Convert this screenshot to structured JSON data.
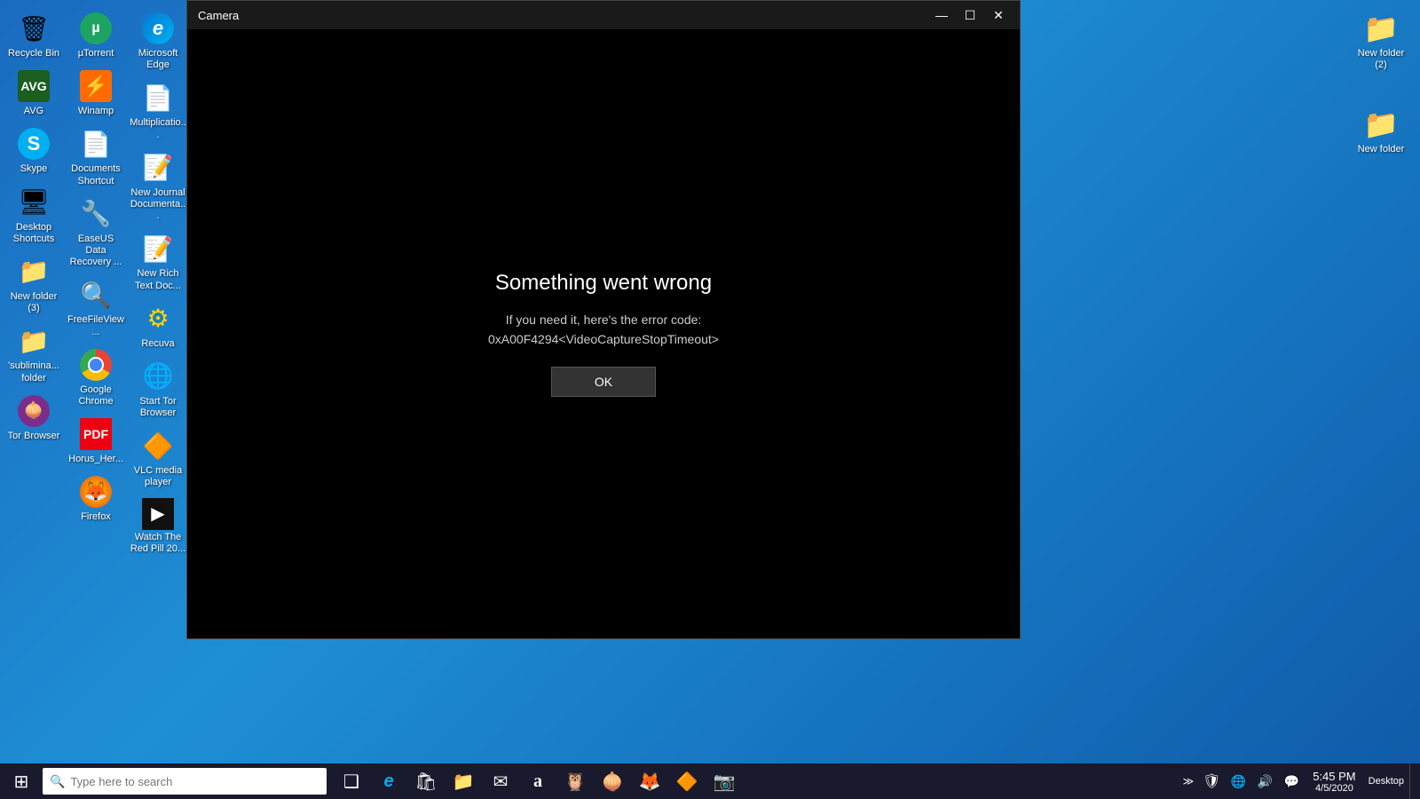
{
  "desktop": {
    "background": "blue gradient"
  },
  "left_icons": {
    "col1": [
      {
        "label": "Recycle Bin",
        "icon": "recycle-bin-icon",
        "symbol": "🗑"
      },
      {
        "label": "AVG",
        "icon": "avg-icon",
        "symbol": "AVG"
      },
      {
        "label": "Skype",
        "icon": "skype-icon",
        "symbol": "S"
      },
      {
        "label": "Desktop Shortcuts",
        "icon": "desktop-shortcuts-icon",
        "symbol": "🖥"
      },
      {
        "label": "New folder (3)",
        "icon": "new-folder3-icon",
        "symbol": "📁"
      },
      {
        "label": "'sublimina... folder",
        "icon": "subliminal-folder-icon",
        "symbol": "📁"
      },
      {
        "label": "Tor Browser",
        "icon": "tor-browser-icon",
        "symbol": "🧅"
      }
    ],
    "col2": [
      {
        "label": "µTorrent",
        "icon": "utorrent-icon",
        "symbol": "µ"
      },
      {
        "label": "Winamp",
        "icon": "winamp-icon",
        "symbol": "⚡"
      },
      {
        "label": "Documents Shortcut",
        "icon": "documents-shortcut-icon",
        "symbol": "📄"
      },
      {
        "label": "EaseUS Data Recovery ...",
        "icon": "easeus-icon",
        "symbol": "🔧"
      },
      {
        "label": "FreeFileView...",
        "icon": "freefileview-icon",
        "symbol": "🔍"
      },
      {
        "label": "Google Chrome",
        "icon": "google-chrome-icon",
        "symbol": ""
      },
      {
        "label": "Horus_Her...",
        "icon": "horus-icon",
        "symbol": "📄"
      },
      {
        "label": "Firefox",
        "icon": "firefox-icon",
        "symbol": "🦊"
      }
    ],
    "col3": [
      {
        "label": "Microsoft Edge",
        "icon": "microsoft-edge-icon",
        "symbol": "e"
      },
      {
        "label": "Multiplicatio...",
        "icon": "multiplication-icon",
        "symbol": "📄"
      },
      {
        "label": "New Journal Documenta...",
        "icon": "new-journal-icon",
        "symbol": "📝"
      },
      {
        "label": "New Rich Text Doc...",
        "icon": "new-richtext-icon",
        "symbol": "📝"
      },
      {
        "label": "Recuva",
        "icon": "recuva-icon",
        "symbol": "🔄"
      },
      {
        "label": "Start Tor Browser",
        "icon": "start-tor-icon",
        "symbol": "🌐"
      },
      {
        "label": "VLC media player",
        "icon": "vlc-icon",
        "symbol": "🔶"
      },
      {
        "label": "Watch The Red Pill 20...",
        "icon": "video-icon",
        "symbol": "▶"
      }
    ]
  },
  "right_icons": [
    {
      "label": "New folder (2)",
      "icon": "new-folder2-icon",
      "symbol": "📁"
    },
    {
      "label": "New folder",
      "icon": "new-folder-icon",
      "symbol": "📁"
    }
  ],
  "camera_window": {
    "title": "Camera",
    "error_title": "Something went wrong",
    "error_message": "If you need it, here's the error code:\n0xA00F4294<VideoCaptureStopTimeout>",
    "ok_button": "OK",
    "minimize_title": "Minimize",
    "maximize_title": "Maximize",
    "close_title": "Close"
  },
  "taskbar": {
    "search_placeholder": "Type here to search",
    "clock_time": "5:45 PM",
    "clock_date": "4/5/2020",
    "desktop_label": "Desktop",
    "icons": [
      {
        "name": "task-view-icon",
        "symbol": "❑"
      },
      {
        "name": "edge-taskbar-icon",
        "symbol": "e"
      },
      {
        "name": "store-taskbar-icon",
        "symbol": "🛍"
      },
      {
        "name": "explorer-taskbar-icon",
        "symbol": "📁"
      },
      {
        "name": "mail-taskbar-icon",
        "symbol": "✉"
      },
      {
        "name": "amazon-taskbar-icon",
        "symbol": "a"
      },
      {
        "name": "tripadvisor-taskbar-icon",
        "symbol": "🦉"
      },
      {
        "name": "tor-taskbar-icon",
        "symbol": "🧅"
      },
      {
        "name": "firefox-taskbar-icon",
        "symbol": "🦊"
      },
      {
        "name": "vlc-taskbar-icon",
        "symbol": "🔶"
      },
      {
        "name": "camera-taskbar-icon",
        "symbol": "📷"
      }
    ],
    "tray": [
      {
        "name": "chevron-tray-icon",
        "symbol": "⌃"
      },
      {
        "name": "antivirus-tray-icon",
        "symbol": "🛡"
      },
      {
        "name": "network-tray-icon",
        "symbol": "🌐"
      },
      {
        "name": "volume-tray-icon",
        "symbol": "🔊"
      },
      {
        "name": "notification-tray-icon",
        "symbol": "💬"
      }
    ]
  }
}
